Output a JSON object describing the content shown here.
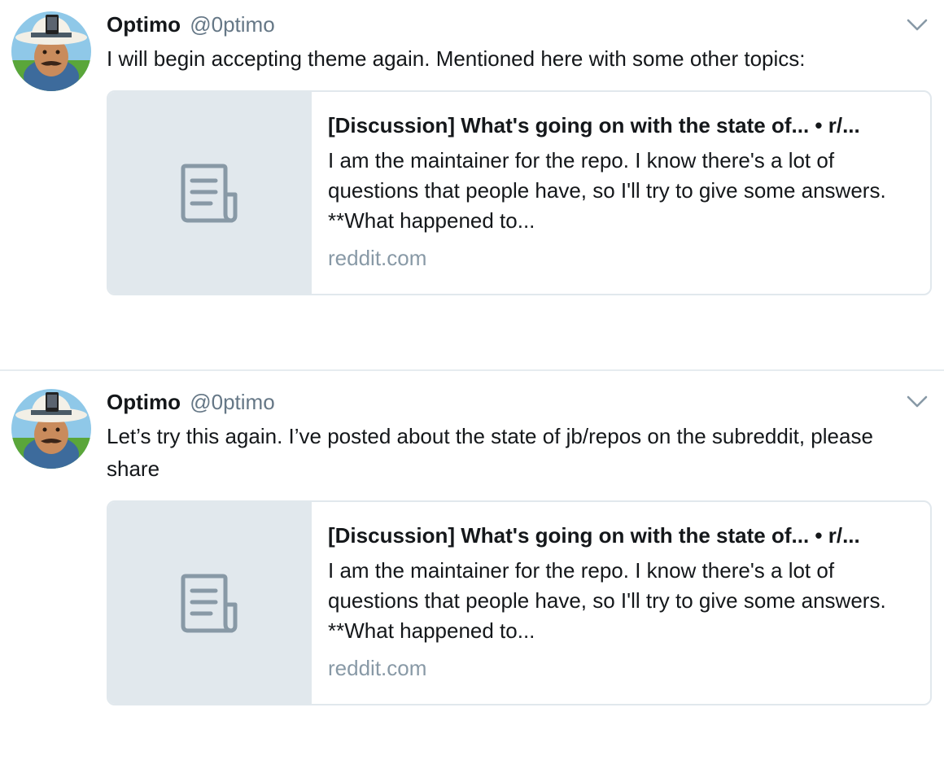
{
  "tweets": [
    {
      "author_name": "Optimo",
      "author_handle": "@0ptimo",
      "text": "I will begin accepting theme again. Mentioned here with some other topics:",
      "card": {
        "title": "[Discussion] What's going on with the state of... • r/...",
        "description": "I am the maintainer for the repo. I know there's a lot of questions that people have, so I'll try to give some answers. **What happened to...",
        "domain": "reddit.com",
        "thumbnail_icon": "document-icon"
      },
      "menu_icon": "chevron-down-icon"
    },
    {
      "author_name": "Optimo",
      "author_handle": "@0ptimo",
      "text": "Let’s try this again. I’ve posted about the state of jb/repos on the subreddit, please share",
      "card": {
        "title": "[Discussion] What's going on with the state of... • r/...",
        "description": "I am the maintainer for the repo. I know there's a lot of questions that people have, so I'll try to give some answers. **What happened to...",
        "domain": "reddit.com",
        "thumbnail_icon": "document-icon"
      },
      "menu_icon": "chevron-down-icon"
    }
  ],
  "colors": {
    "text_primary": "#14171a",
    "text_secondary": "#657786",
    "domain_text": "#8899a6",
    "card_border": "#e1e8ed",
    "thumbnail_bg": "#e1e8ed",
    "icon_gray": "#8899a6",
    "divider": "#e6ecf0"
  }
}
